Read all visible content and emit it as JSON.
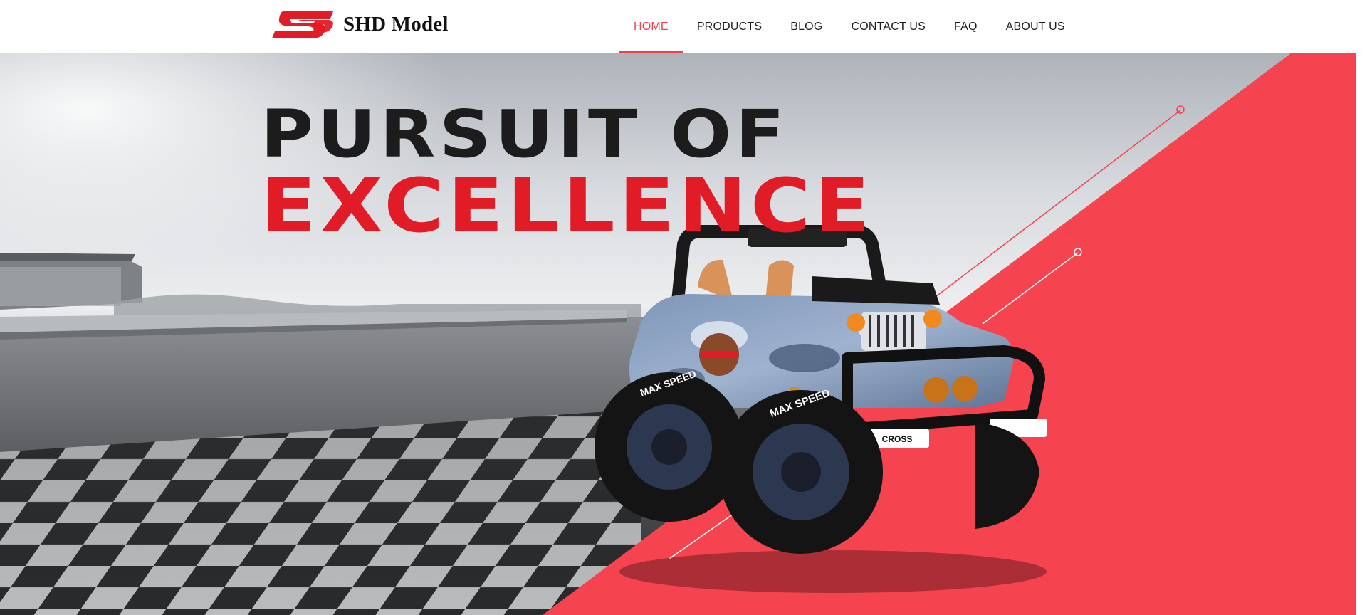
{
  "site": {
    "brand_name": "SHD Model",
    "logo_icon": "ss-logo-mark",
    "accent_color": "#f0404c"
  },
  "nav": {
    "items": [
      {
        "label": "HOME",
        "active": true
      },
      {
        "label": "PRODUCTS",
        "active": false
      },
      {
        "label": "BLOG",
        "active": false
      },
      {
        "label": "CONTACT US",
        "active": false
      },
      {
        "label": "FAQ",
        "active": false
      },
      {
        "label": "ABOUT US",
        "active": false
      }
    ]
  },
  "hero": {
    "headline_line1": "PURSUIT OF",
    "headline_line2": "EXCELLENCE",
    "headline_line1_color": "#1c1c1c",
    "headline_line2_color": "#e21c26",
    "panel_color": "#f5434f",
    "background": "racetrack-checkered-flag",
    "product": "toy-off-road-jeep",
    "tire_text": "MAX SPEED",
    "plate_text": "CROSS"
  }
}
